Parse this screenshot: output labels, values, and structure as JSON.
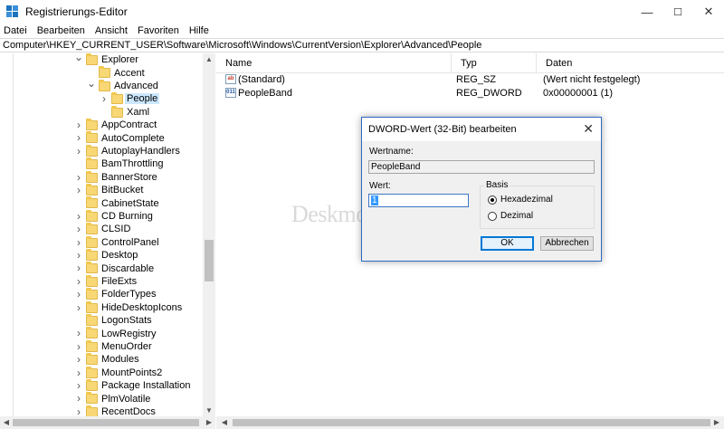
{
  "window": {
    "title": "Registrierungs-Editor",
    "minimize": "—",
    "maximize": "☐",
    "close": "✕"
  },
  "menu": [
    "Datei",
    "Bearbeiten",
    "Ansicht",
    "Favoriten",
    "Hilfe"
  ],
  "address": "Computer\\HKEY_CURRENT_USER\\Software\\Microsoft\\Windows\\CurrentVersion\\Explorer\\Advanced\\People",
  "tree": {
    "items": [
      {
        "label": "Explorer",
        "chevron": "v"
      },
      {
        "label": "Accent",
        "chevron": ""
      },
      {
        "label": "Advanced",
        "chevron": "v"
      },
      {
        "label": "People",
        "chevron": ">",
        "selected": true
      },
      {
        "label": "Xaml",
        "chevron": ""
      },
      {
        "label": "AppContract",
        "chevron": ">"
      },
      {
        "label": "AutoComplete",
        "chevron": ">"
      },
      {
        "label": "AutoplayHandlers",
        "chevron": ">"
      },
      {
        "label": "BamThrottling",
        "chevron": ""
      },
      {
        "label": "BannerStore",
        "chevron": ">"
      },
      {
        "label": "BitBucket",
        "chevron": ">"
      },
      {
        "label": "CabinetState",
        "chevron": ""
      },
      {
        "label": "CD Burning",
        "chevron": ">"
      },
      {
        "label": "CLSID",
        "chevron": ">"
      },
      {
        "label": "ControlPanel",
        "chevron": ">"
      },
      {
        "label": "Desktop",
        "chevron": ">"
      },
      {
        "label": "Discardable",
        "chevron": ">"
      },
      {
        "label": "FileExts",
        "chevron": ">"
      },
      {
        "label": "FolderTypes",
        "chevron": ">"
      },
      {
        "label": "HideDesktopIcons",
        "chevron": ">"
      },
      {
        "label": "LogonStats",
        "chevron": ""
      },
      {
        "label": "LowRegistry",
        "chevron": ">"
      },
      {
        "label": "MenuOrder",
        "chevron": ">"
      },
      {
        "label": "Modules",
        "chevron": ">"
      },
      {
        "label": "MountPoints2",
        "chevron": ">"
      },
      {
        "label": "Package Installation",
        "chevron": ">"
      },
      {
        "label": "PlmVolatile",
        "chevron": ">"
      },
      {
        "label": "RecentDocs",
        "chevron": ">"
      }
    ]
  },
  "list": {
    "columns": [
      "Name",
      "Typ",
      "Daten"
    ],
    "rows": [
      {
        "icon": "ab",
        "name": "(Standard)",
        "type": "REG_SZ",
        "data": "(Wert nicht festgelegt)"
      },
      {
        "icon": "011",
        "name": "PeopleBand",
        "type": "REG_DWORD",
        "data": "0x00000001 (1)"
      }
    ]
  },
  "watermark": "Deskmodder.de",
  "dialog": {
    "title": "DWORD-Wert (32-Bit) bearbeiten",
    "close": "✕",
    "name_label": "Wertname:",
    "name_value": "PeopleBand",
    "value_label": "Wert:",
    "value_value": "1",
    "base_label": "Basis",
    "radio_hex": "Hexadezimal",
    "radio_dec": "Dezimal",
    "selected_base": "Hexadezimal",
    "ok": "OK",
    "cancel": "Abbrechen"
  },
  "colors": {
    "selection": "#cce8ff",
    "folder": "#f8d775",
    "accent": "#0078d7"
  }
}
